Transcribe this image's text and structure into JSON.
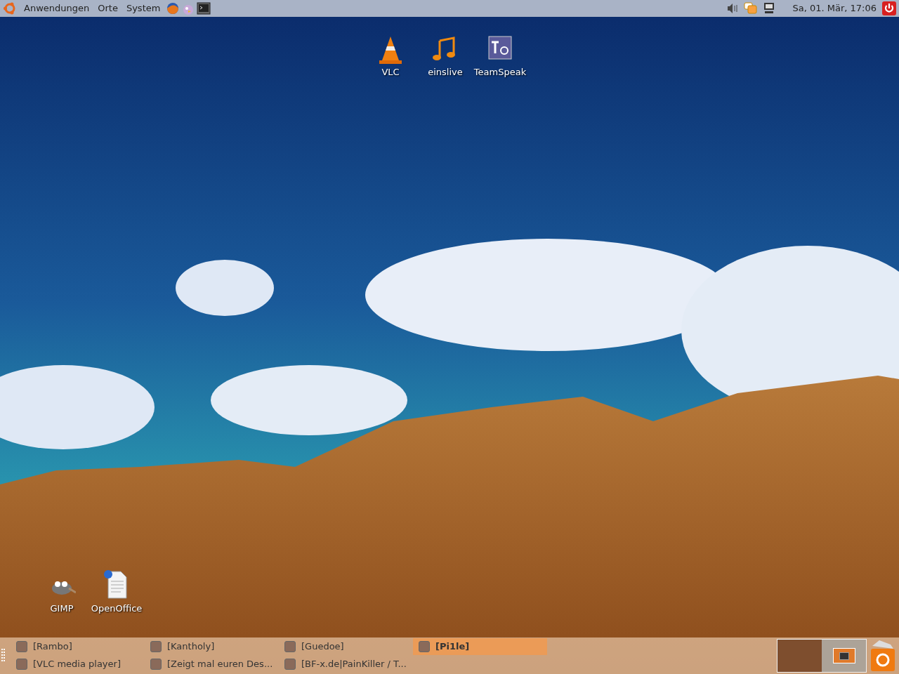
{
  "top_panel": {
    "menus": [
      {
        "label": "Anwendungen"
      },
      {
        "label": "Orte"
      },
      {
        "label": "System"
      }
    ],
    "launchers": [
      {
        "kind": "browser"
      },
      {
        "kind": "chat"
      },
      {
        "kind": "terminal"
      }
    ],
    "clock": "Sa, 01. Mär, 17:06"
  },
  "desktop_icons": [
    {
      "label": "VLC",
      "kind": "cone"
    },
    {
      "label": "einslive",
      "kind": "note"
    },
    {
      "label": "TeamSpeak",
      "kind": "ts"
    },
    {
      "label": "GIMP",
      "kind": "gimp"
    },
    {
      "label": "OpenOffice",
      "kind": "doc"
    }
  ],
  "taskbar": {
    "windows": [
      {
        "label": "[Rambo]",
        "selected": false
      },
      {
        "label": "[Kantholy]",
        "selected": false
      },
      {
        "label": "[Guedoe]",
        "selected": false
      },
      {
        "label": "[Pi1le]",
        "selected": true
      },
      {
        "label": "[VLC media player]",
        "selected": false
      },
      {
        "label": "[Zeigt mal euren Des...",
        "selected": false
      },
      {
        "label": "[BF-x.de|PainKiller / T...",
        "selected": false
      }
    ],
    "workspaces": [
      {
        "selected": true
      },
      {
        "selected": false
      }
    ]
  }
}
